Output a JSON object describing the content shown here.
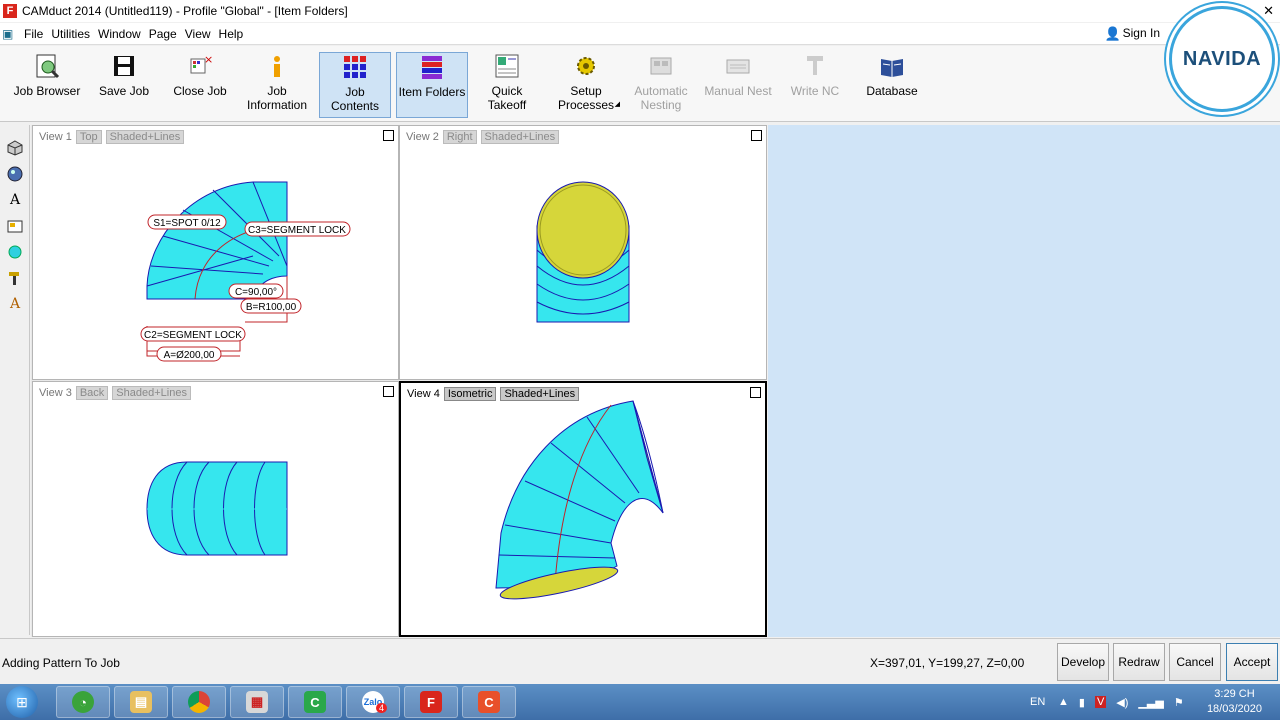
{
  "window": {
    "title": "CAMduct 2014 (Untitled119) - Profile \"Global\" - [Item Folders]",
    "app_glyph": "F",
    "controls": [
      "–",
      "□",
      "✕"
    ]
  },
  "menu": {
    "items": [
      "File",
      "Utilities",
      "Window",
      "Page",
      "Help"
    ],
    "window_item": "Window",
    "view_item": "View",
    "signin": "Sign In"
  },
  "ribbon": {
    "buttons": [
      {
        "label1": "Job Browser",
        "label2": ""
      },
      {
        "label1": "Save Job",
        "label2": ""
      },
      {
        "label1": "Close Job",
        "label2": ""
      },
      {
        "label1": "Job",
        "label2": "Information"
      },
      {
        "label1": "Job",
        "label2": "Contents"
      },
      {
        "label1": "Item Folders",
        "label2": ""
      },
      {
        "label1": "Quick",
        "label2": "Takeoff"
      },
      {
        "label1": "Setup",
        "label2": "Processes"
      },
      {
        "label1": "Automatic",
        "label2": "Nesting"
      },
      {
        "label1": "Manual Nest",
        "label2": ""
      },
      {
        "label1": "Write NC",
        "label2": ""
      },
      {
        "label1": "Database",
        "label2": ""
      }
    ]
  },
  "views": [
    {
      "name": "View 1",
      "projection": "Top",
      "style": "Shaded+Lines"
    },
    {
      "name": "View 2",
      "projection": "Right",
      "style": "Shaded+Lines"
    },
    {
      "name": "View 3",
      "projection": "Back",
      "style": "Shaded+Lines"
    },
    {
      "name": "View 4",
      "projection": "Isometric",
      "style": "Shaded+Lines"
    }
  ],
  "annotations": {
    "s1": "S1=SPOT 0/12",
    "c3": "C3=SEGMENT LOCK",
    "c": "C=90,00°",
    "b": "B=R100,00",
    "c2": "C2=SEGMENT LOCK",
    "a": "A=Ø200,00"
  },
  "status": {
    "message": "Adding Pattern To Job",
    "coords": "X=397,01, Y=199,27, Z=0,00",
    "buttons": [
      "Develop",
      "Redraw",
      "Cancel",
      "Accept"
    ]
  },
  "taskbar": {
    "zalo_badge": "4",
    "zalo_label": "Zalo",
    "lang": "EN",
    "time": "3:29 CH",
    "date": "18/03/2020"
  },
  "logo": "NAVIDA",
  "colors": {
    "duct": "#36e6ee",
    "duct_edge": "#1a1ab0",
    "seam": "#c0242a",
    "inner": "#d6d63a",
    "canvas": "#d0e4f7"
  }
}
